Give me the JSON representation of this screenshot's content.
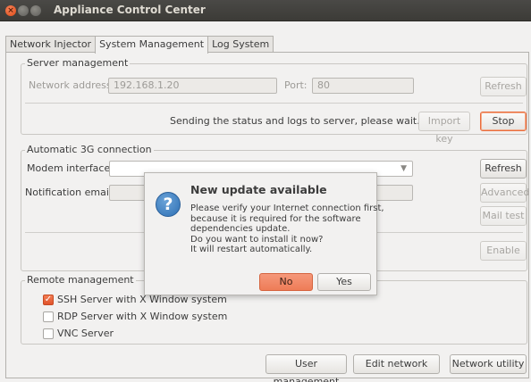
{
  "window": {
    "title": "Appliance Control Center"
  },
  "tabs": [
    {
      "label": "Network Injector"
    },
    {
      "label": "System Management"
    },
    {
      "label": "Log System"
    }
  ],
  "server": {
    "frame_label": "Server management",
    "address_label": "Network address:",
    "address_value": "192.168.1.20",
    "port_label": "Port:",
    "port_value": "80",
    "refresh_label": "Refresh",
    "status_text": "Sending the status and logs to server, please wait...",
    "import_key_label": "Import key",
    "stop_label": "Stop"
  },
  "g3": {
    "frame_label": "Automatic 3G connection",
    "modem_label": "Modem interface:",
    "modem_value": "",
    "email_label": "Notification email:",
    "refresh_label": "Refresh",
    "advanced_label": "Advanced",
    "mailtest_label": "Mail test",
    "enable_label": "Enable"
  },
  "remote": {
    "frame_label": "Remote management",
    "options": [
      {
        "label": "SSH Server with X Window system",
        "checked": true
      },
      {
        "label": "RDP Server with X Window system",
        "checked": false
      },
      {
        "label": "VNC Server",
        "checked": false
      }
    ]
  },
  "bottom": {
    "user_management_label": "User management",
    "edit_network_label": "Edit network",
    "network_utility_label": "Network utility"
  },
  "dialog": {
    "title": "New update available",
    "body_lines": [
      "Please verify your Internet connection first,",
      "because it is required for the software",
      "dependencies update.",
      "Do you want to install it now?",
      "It will restart automatically."
    ],
    "no_label": "No",
    "yes_label": "Yes",
    "icon": "question-icon"
  }
}
